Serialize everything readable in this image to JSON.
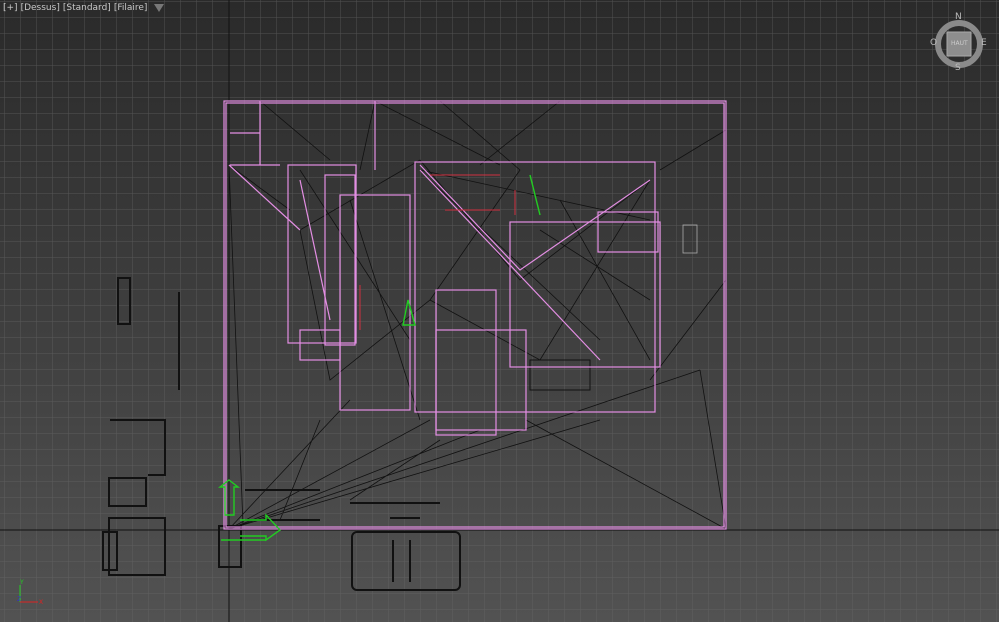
{
  "viewport_label": {
    "plus": "[+]",
    "view": "[Dessus]",
    "shading_preset": "[Standard]",
    "mode": "[Filaire]"
  },
  "viewcube": {
    "face": "HAUT",
    "north": "N",
    "south": "S",
    "east": "E",
    "west": "O"
  },
  "axis_tripod": {
    "x": "X",
    "y": "Y",
    "z": "Z"
  },
  "colors": {
    "selection": "#e38ee3",
    "gizmo": "#22cc22",
    "wire": "#111111"
  }
}
